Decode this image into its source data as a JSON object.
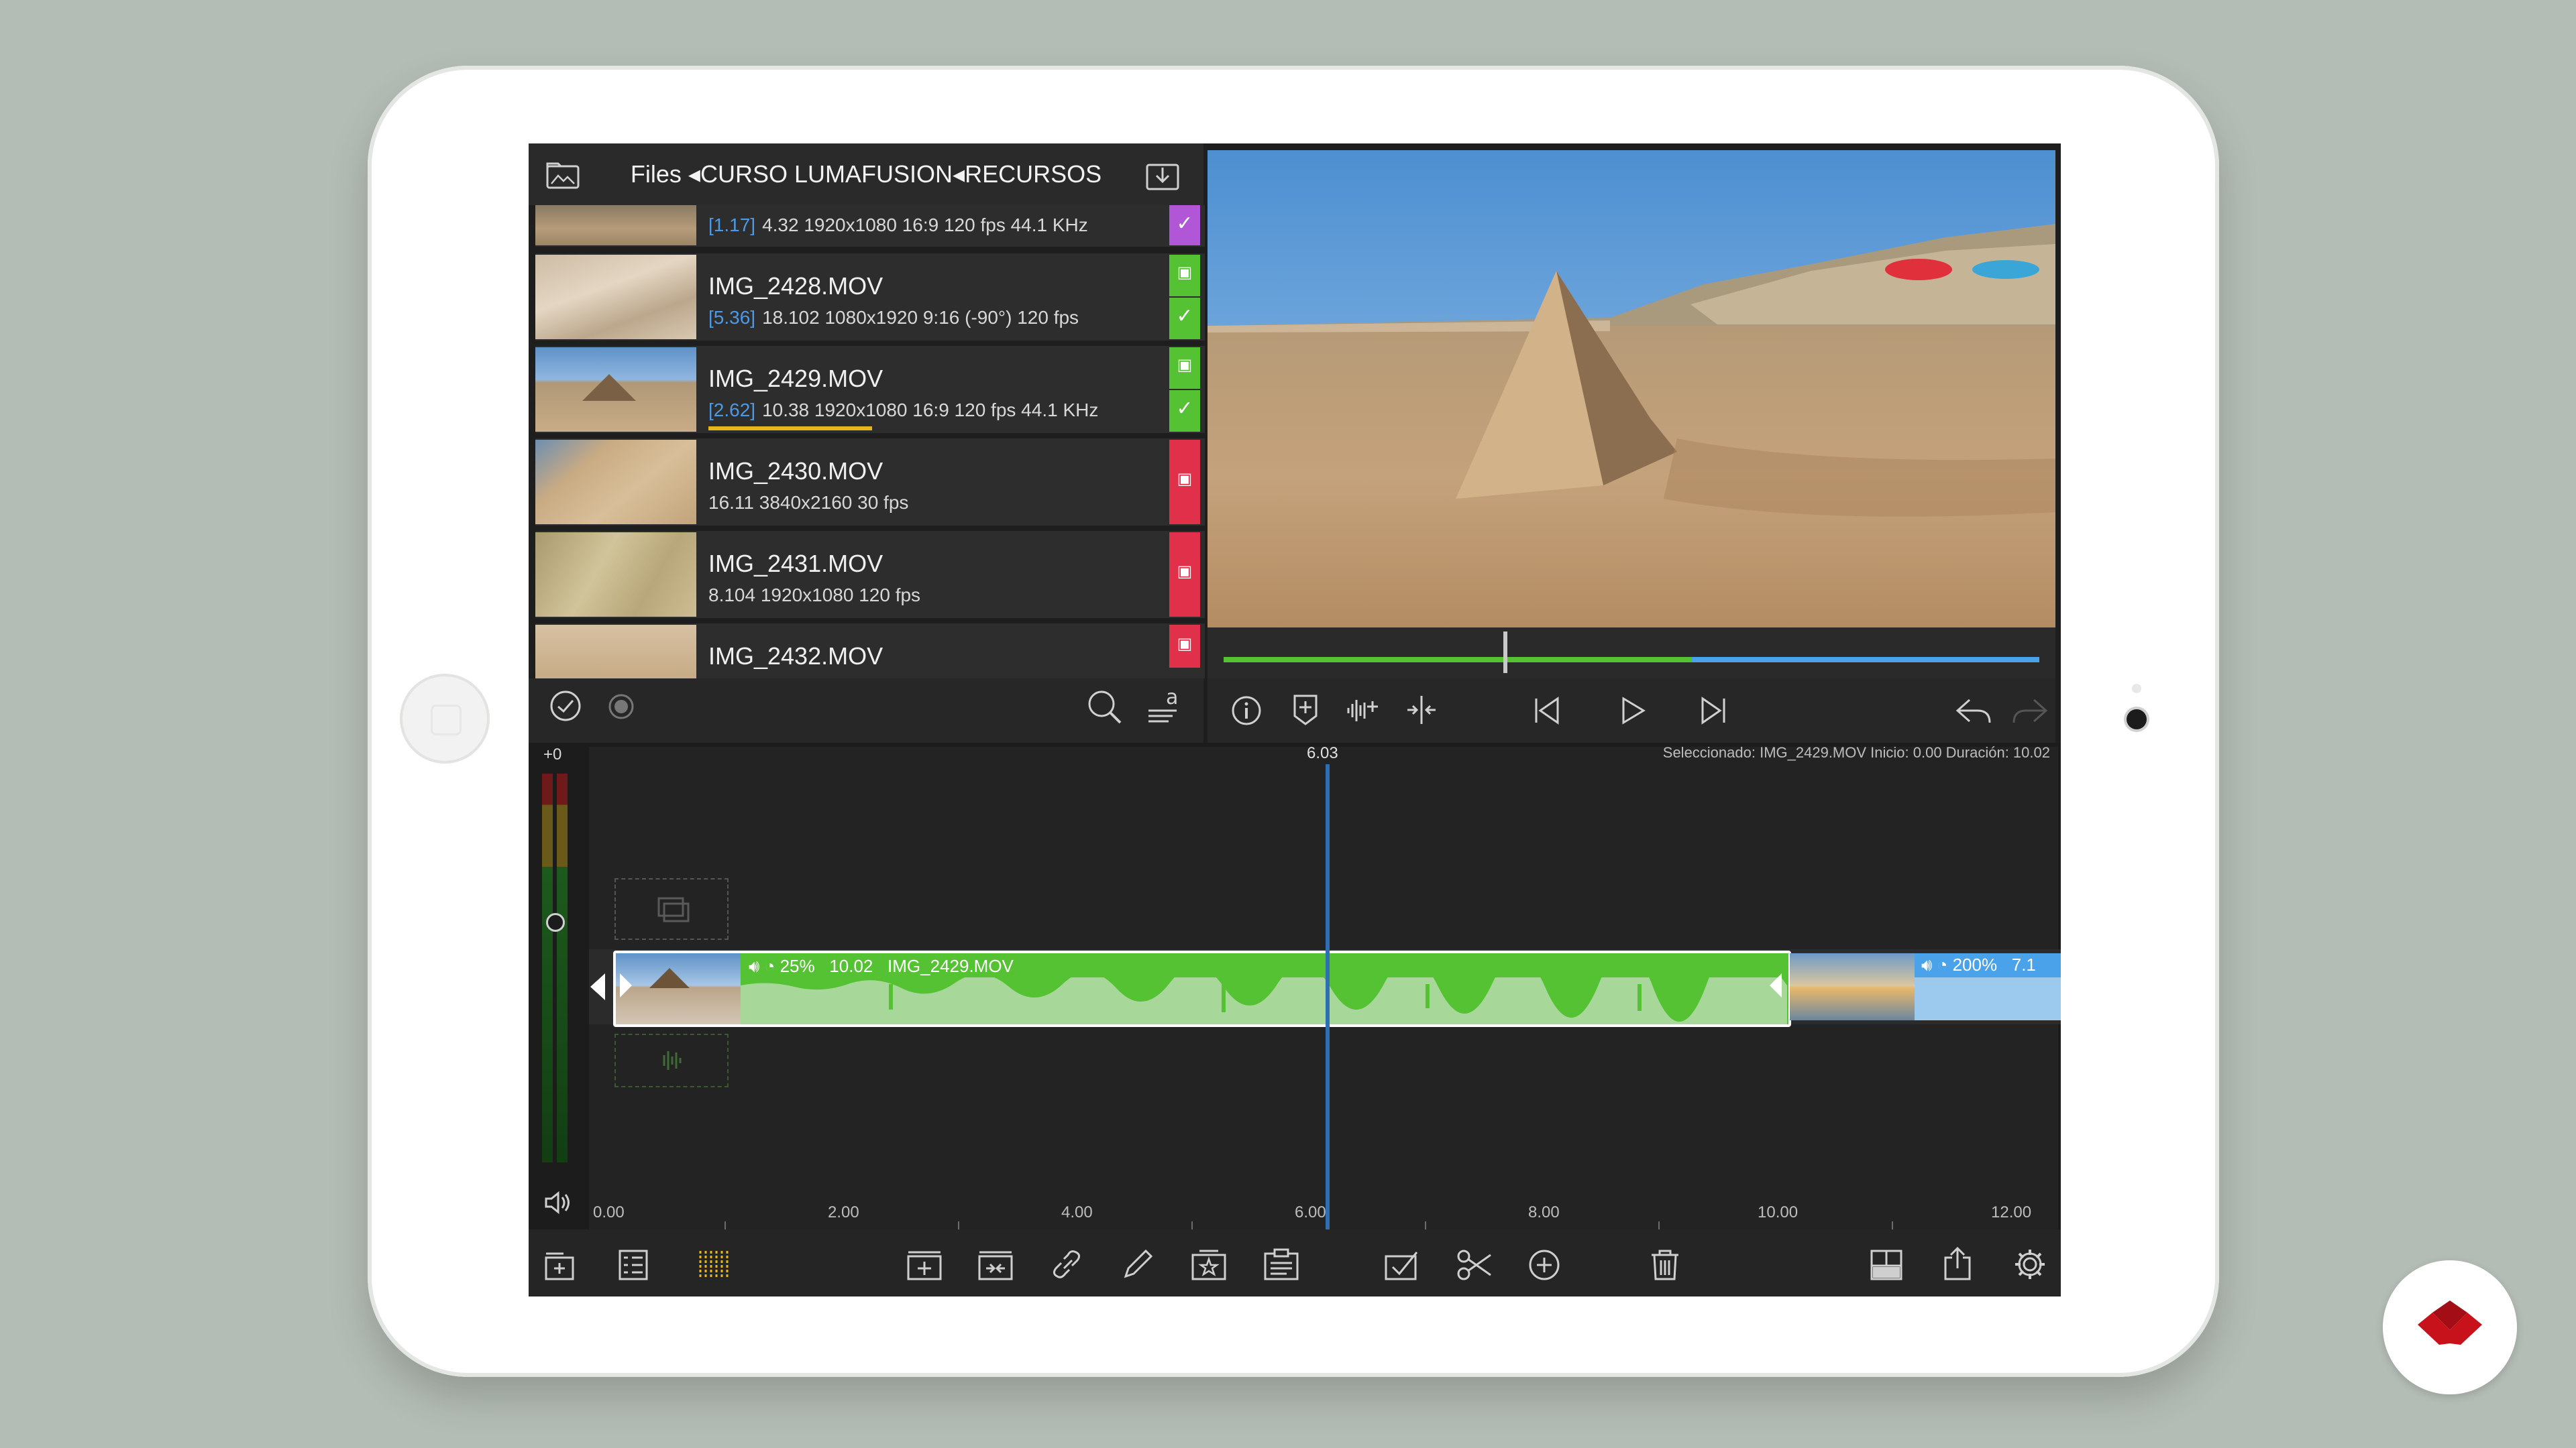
{
  "library": {
    "path": "Files ◂CURSO LUMAFUSION◂RECURSOS",
    "clips": [
      {
        "name": "",
        "duration_bracket": "[1.17]",
        "meta": "4.32  1920x1080  16:9  120 fps  44.1 KHz",
        "badge": "purple"
      },
      {
        "name": "IMG_2428.MOV",
        "duration_bracket": "[5.36]",
        "meta": "18.102  1080x1920  9:16  (-90°)  120 fps",
        "badge": "green"
      },
      {
        "name": "IMG_2429.MOV",
        "duration_bracket": "[2.62]",
        "meta": "10.38  1920x1080  16:9  120 fps  44.1 KHz",
        "badge": "green"
      },
      {
        "name": "IMG_2430.MOV",
        "duration_bracket": "",
        "meta": "16.11  3840x2160  30 fps",
        "badge": "red"
      },
      {
        "name": "IMG_2431.MOV",
        "duration_bracket": "",
        "meta": "8.104  1920x1080  120 fps",
        "badge": "red"
      },
      {
        "name": "IMG_2432.MOV",
        "duration_bracket": "",
        "meta": "",
        "badge": "red"
      }
    ]
  },
  "timeline": {
    "playhead_label": "6.03",
    "playhead_seconds": 6.03,
    "volume_label": "+0",
    "selection_info": "Seleccionado: IMG_2429.MOV Inicio: 0.00 Duración: 10.02",
    "clip_main": {
      "speed": "25%",
      "duration": "10.02",
      "name": "IMG_2429.MOV"
    },
    "clip_next": {
      "speed": "200%",
      "duration": "7.1"
    },
    "ruler": [
      "0.00",
      "2.00",
      "4.00",
      "6.00",
      "8.00",
      "10.00",
      "12.00"
    ]
  },
  "colors": {
    "green": "#55c233",
    "blue": "#4aa3ea",
    "red": "#e0304a",
    "purple": "#b056d6",
    "playhead": "#2f6fb1",
    "accent_yellow": "#e6b619"
  },
  "icons": {
    "library_toolbar": [
      "check-circle-icon",
      "record-dot-icon",
      "search-icon",
      "sort-text-icon"
    ],
    "viewer_toolbar": [
      "info-icon",
      "add-marker-icon",
      "audio-split-icon",
      "split-icon",
      "previous-frame-icon",
      "play-icon",
      "next-frame-icon",
      "undo-icon",
      "redo-icon"
    ],
    "bottom_toolbar": [
      "add-track-icon",
      "list-view-icon",
      "timeline-view-icon",
      "insert-icon",
      "overwrite-icon",
      "link-icon",
      "pencil-icon",
      "favorite-icon",
      "clipboard-icon",
      "select-icon",
      "cut-icon",
      "add-icon",
      "trash-icon",
      "layout-icon",
      "share-icon",
      "settings-icon"
    ]
  }
}
